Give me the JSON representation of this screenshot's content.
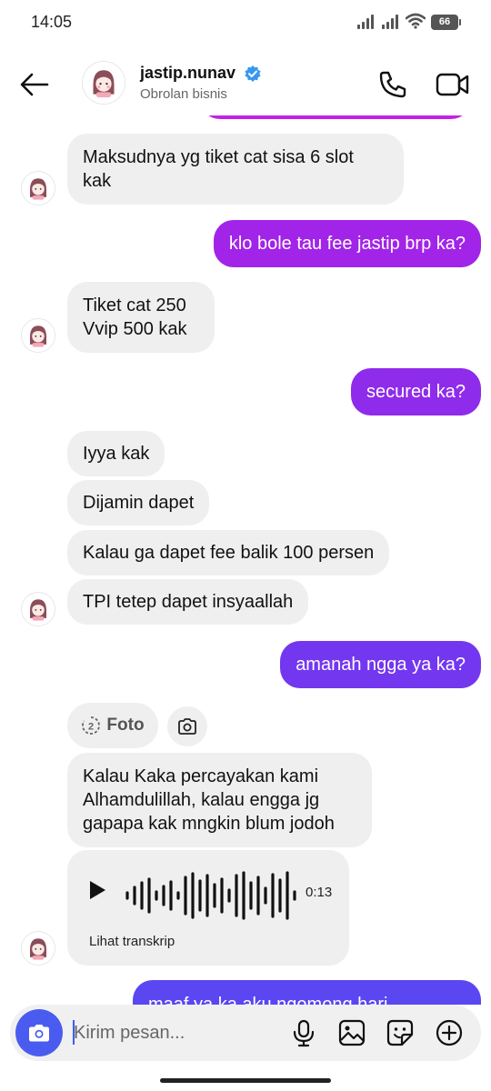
{
  "status_bar": {
    "time": "14:05",
    "battery": "66"
  },
  "header": {
    "name": "jastip.nunav",
    "subtitle": "Obrolan bisnis"
  },
  "colors": {
    "accent": "#4a5cf0",
    "bubble_in": "#efefef",
    "verified": "#3897f0"
  },
  "messages": [
    {
      "side": "in",
      "line1": "Maksudnya yg tiket cat sisa 6 slot",
      "line2": "kak"
    },
    {
      "side": "out",
      "text": "klo bole tau fee jastip brp ka?",
      "color": "#a224e8"
    },
    {
      "side": "in",
      "line1": "Tiket cat 250",
      "line2": "Vvip 500 kak"
    },
    {
      "side": "out",
      "text": "secured ka?",
      "color": "#8f2bea"
    },
    {
      "side": "in",
      "text": "Iyya kak"
    },
    {
      "side": "in",
      "text": "Dijamin dapet"
    },
    {
      "side": "in",
      "text": "Kalau ga dapet fee balik 100 persen"
    },
    {
      "side": "in",
      "text": "TPI tetep dapet insyaallah"
    },
    {
      "side": "out",
      "text": "amanah ngga ya ka?",
      "color": "#7437f0"
    },
    {
      "side": "in",
      "line1": "Kalau Kaka percayakan kami",
      "line2": "Alhamdulillah, kalau engga jg",
      "line3": "gapapa kak mngkin blum jodoh"
    },
    {
      "side": "out",
      "text": "maaf ya ka aku ngomong hari",
      "color": "#5a47f2"
    }
  ],
  "attachment": {
    "count": "2",
    "label": "Foto"
  },
  "voice_note": {
    "duration": "0:13",
    "transcript_link": "Lihat transkrip"
  },
  "composer": {
    "placeholder": "Kirim pesan..."
  }
}
